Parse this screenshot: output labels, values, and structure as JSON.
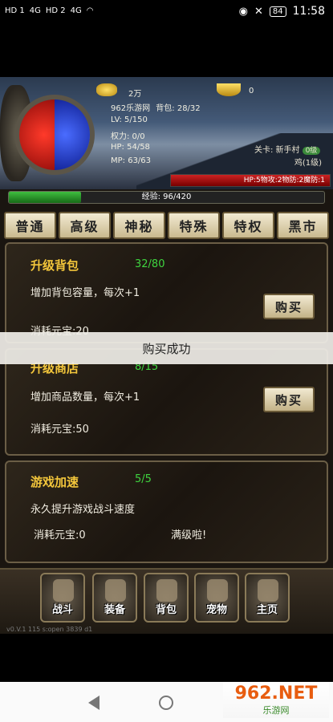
{
  "status": {
    "left_labels": [
      "HD 1",
      "4G",
      "HD 2",
      "4G"
    ],
    "battery": "84",
    "time": "11:58"
  },
  "hero": {
    "gold": "2万",
    "ingot": "0",
    "name": "962乐游网",
    "bag": "背包: 28/32",
    "lv": "LV: 5/150",
    "power": "权力: 0/0",
    "hp": "HP: 54/58",
    "mp": "MP: 63/63",
    "stage_label": "关卡: 新手村",
    "stage_level": "0级",
    "pet_name": "鸡(1级)",
    "pet_stats": "HP:5物攻:2物防:2魔防:1"
  },
  "exp": {
    "text": "经验: 96/420",
    "fraction": 0.229
  },
  "tabs": [
    {
      "label": "普通"
    },
    {
      "label": "高级"
    },
    {
      "label": "神秘"
    },
    {
      "label": "特殊"
    },
    {
      "label": "特权"
    },
    {
      "label": "黑市"
    }
  ],
  "items": [
    {
      "title": "升级背包",
      "count": "32/80",
      "desc": "增加背包容量，每次+1",
      "cost": "消耗元宝:20",
      "buy": "购买"
    },
    {
      "title": "升级商店",
      "count": "8/15",
      "desc": "增加商品数量，每次+1",
      "cost": "消耗元宝:50",
      "buy": "购买"
    },
    {
      "title": "游戏加速",
      "count": "5/5",
      "desc": "永久提升游戏战斗速度",
      "cost": "消耗元宝:0",
      "maxed": "满级啦!"
    }
  ],
  "toast": "购买成功",
  "bottom": [
    {
      "label": "战斗",
      "icon": "swords-icon"
    },
    {
      "label": "装备",
      "icon": "armor-icon"
    },
    {
      "label": "背包",
      "icon": "bag-icon"
    },
    {
      "label": "宠物",
      "icon": "helmet-icon"
    },
    {
      "label": "主页",
      "icon": "door-icon"
    }
  ],
  "version": "v0.V.1 115 s:open 3839 d1",
  "watermark": {
    "brand": "962.NET",
    "sub": "乐游网"
  }
}
